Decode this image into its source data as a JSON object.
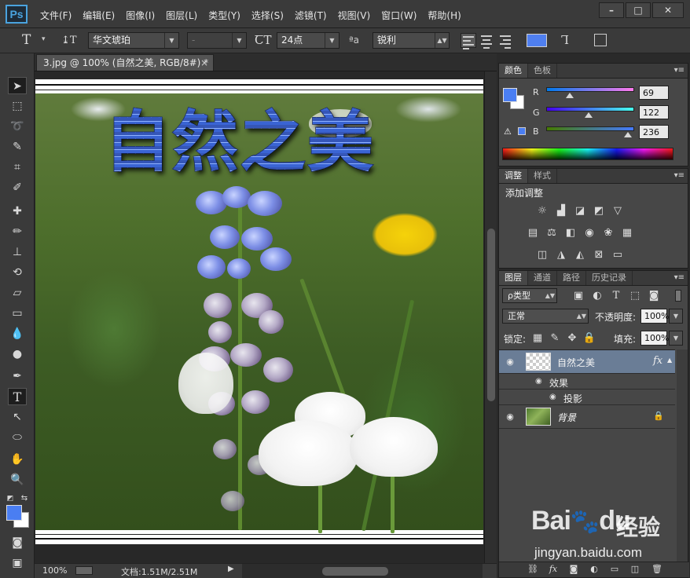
{
  "app": {
    "logo": "Ps",
    "menu": [
      "文件(F)",
      "编辑(E)",
      "图像(I)",
      "图层(L)",
      "类型(Y)",
      "选择(S)",
      "滤镜(T)",
      "视图(V)",
      "窗口(W)",
      "帮助(H)"
    ],
    "window_controls": {
      "minimize": "–",
      "maximize": "□",
      "close": "✕"
    }
  },
  "options": {
    "tool_glyph": "T",
    "tool_arrow": "▾",
    "orient_glyph": "↨T",
    "font_family": "华文琥珀",
    "font_style": "-",
    "size_glyph": "ꞆT",
    "font_size": "24点",
    "aa_glyph": "ªa",
    "antialias": "锐利",
    "text_color": "#4f7ff0"
  },
  "document": {
    "tab_title": "3.jpg @ 100% (自然之美, RGB/8#) *",
    "tab_close": "×",
    "title_text": "自然之美"
  },
  "status": {
    "zoom": "100%",
    "doc_info": "文档:1.51M/2.51M",
    "arrow": "▶"
  },
  "color_panel": {
    "tabs": [
      "颜色",
      "色板"
    ],
    "r_label": "R",
    "g_label": "G",
    "b_label": "B",
    "r_value": "69",
    "g_value": "122",
    "b_value": "236",
    "r": 69,
    "g": 122,
    "b": 236,
    "fg": "#4a7ef2",
    "bg": "#ffffff"
  },
  "adjust_panel": {
    "tabs": [
      "调整",
      "样式"
    ],
    "title": "添加调整"
  },
  "layers_panel": {
    "tabs": [
      "图层",
      "通道",
      "路径",
      "历史记录"
    ],
    "filter": "ρ类型",
    "blend_mode": "正常",
    "opacity_label": "不透明度:",
    "opacity": "100%",
    "lock_label": "锁定:",
    "fill_label": "填充:",
    "fill": "100%",
    "layers": [
      {
        "name": "自然之美",
        "fx": "fx",
        "effects_label": "效果",
        "effect": "投影"
      },
      {
        "name": "背景"
      }
    ]
  },
  "watermark": {
    "logo": "Bai",
    "logo_suffix": "du",
    "cn": "经验",
    "url": "jingyan.baidu.com"
  }
}
